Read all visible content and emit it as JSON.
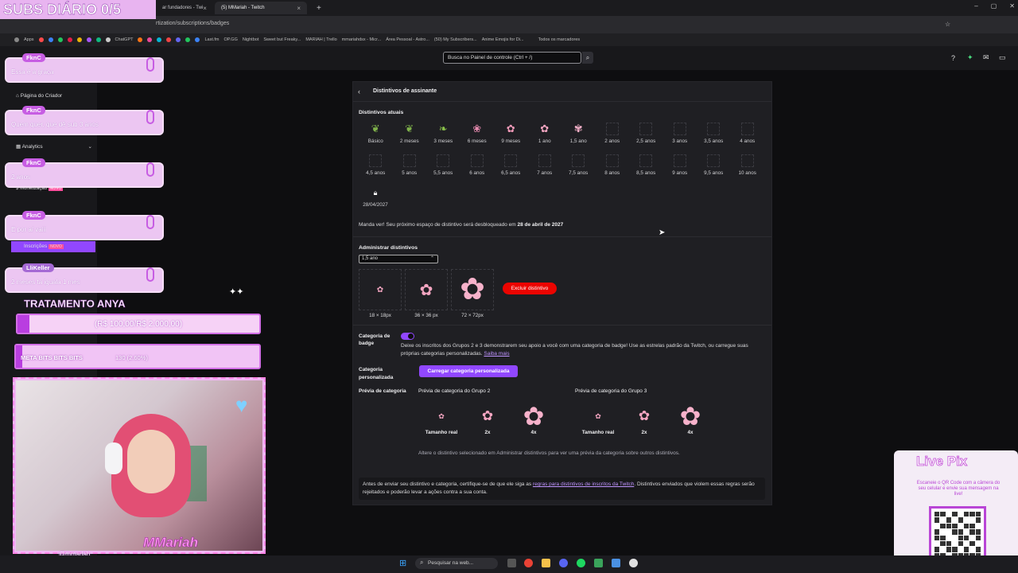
{
  "browser": {
    "tabs": [
      {
        "label": "ar fundadores - Twi"
      },
      {
        "label": "(5) MMariah - Twitch"
      }
    ],
    "url": "rtization/subscriptions/badges",
    "bookmarks": [
      "Apps",
      "ChatGPT",
      "Last.fm",
      "OP.GG",
      "Nightbot",
      "Sweet but Freaky...",
      "MARIAH | Trello",
      "mmariahdsx - Micr...",
      "Área Pessoal - Astro...",
      "(50) My Subscribers...",
      "Anime Emojis for Di...",
      "Todos os marcadores"
    ]
  },
  "topnav": {
    "search_placeholder": "Busca no Painel de controle (Ctrl + /)"
  },
  "sidebar": {
    "creator_page": "Página do Criador",
    "analytics": "Analytics",
    "monetization": "Monetização",
    "new_badge": "NOVO",
    "subscriptions": "Inscrições",
    "subs_new": "NOVO"
  },
  "panel": {
    "title": "Distintivos de assinante",
    "current_heading": "Distintivos atuais",
    "badges_row1": [
      "Básico",
      "2 meses",
      "3 meses",
      "6 meses",
      "9 meses",
      "1 ano",
      "1,5 ano",
      "2 anos",
      "2,5 anos",
      "3 anos",
      "3,5 anos",
      "4 anos"
    ],
    "badges_row2": [
      "4,5 anos",
      "5 anos",
      "5,5 anos",
      "6 anos",
      "6,5 anos",
      "7 anos",
      "7,5 anos",
      "8 anos",
      "8,5 anos",
      "9 anos",
      "9,5 anos",
      "10 anos"
    ],
    "locked_date": "28/04/2027",
    "next_slot_prefix": "Manda ver! Seu próximo espaço de distintivo será desbloqueado em ",
    "next_slot_date": "28 de abril de 2027",
    "manage_heading": "Administrar distintivos",
    "selected_badge": "1,5 ano",
    "sizes": [
      "18 × 18px",
      "36 × 36 px",
      "72 × 72px"
    ],
    "delete_label": "Excluir distintivo",
    "category_label": "Categoria de badge",
    "category_text": "Deixe os inscritos dos Grupos 2 e 3 demonstrarem seu apoio a você com uma categoria de badge! Use as estrelas padrão da Twitch, ou carregue suas próprias categorias personalizadas. ",
    "learn_more": "Saiba mais",
    "custom_category_label": "Categoria personalizada",
    "upload_label": "Carregar categoria personalizada",
    "preview_label": "Prévia de categoria",
    "group2": "Prévia de categoria do Grupo 2",
    "group3": "Prévia de categoria do Grupo 3",
    "preview_sizes": [
      "Tamanho real",
      "2x",
      "4x"
    ],
    "preview_hint": "Altere o distintivo selecionado em Administrar distintivos para ver uma prévia da categoria sobre outros distintivos.",
    "notice_pre": "Antes de enviar seu distintivo e categoria, certifique-se de que ele siga as ",
    "notice_link": "regras para distintivos de inscritos da Twitch",
    "notice_post": ". Distintivos enviados que violem essas regras serão rejeitados e poderão levar a ações contra a sua conta."
  },
  "overlay": {
    "title": "SUBS DIÁRIO 0/5",
    "chats": [
      {
        "name": "FknC",
        "msg": "Essa é a graça"
      },
      {
        "name": "FknC",
        "msg": "Quem quer, que dê sub 3 anos"
      },
      {
        "name": "FknC",
        "msg": "2 anos"
      },
      {
        "name": "FknC",
        "msg": "E por aí vaiii"
      },
      {
        "name": "LliKeller",
        "msg": "2 meses ta iguala 1 mes"
      }
    ],
    "goal_title": "TRATAMENTO ANYA",
    "goal_value": "(R$ 100,00/R$ 2.000,00)",
    "goal_progress": 0.05,
    "bits_name": "META BITS BITS BITS",
    "bits_value": "130 (2.60%)",
    "bits_progress": 0.026,
    "cam_name": "MMariah",
    "handle": "@mmariah",
    "livepix_title": "Live Pix",
    "livepix_text": "Escaneie o QR Code com a câmera do seu celular e envie sua mensagem na live!"
  },
  "taskbar": {
    "search": "Pesquisar na web..."
  },
  "colors": {
    "accent": "#9147ff",
    "danger": "#eb0400",
    "overlay_pink": "#d26fe6"
  }
}
